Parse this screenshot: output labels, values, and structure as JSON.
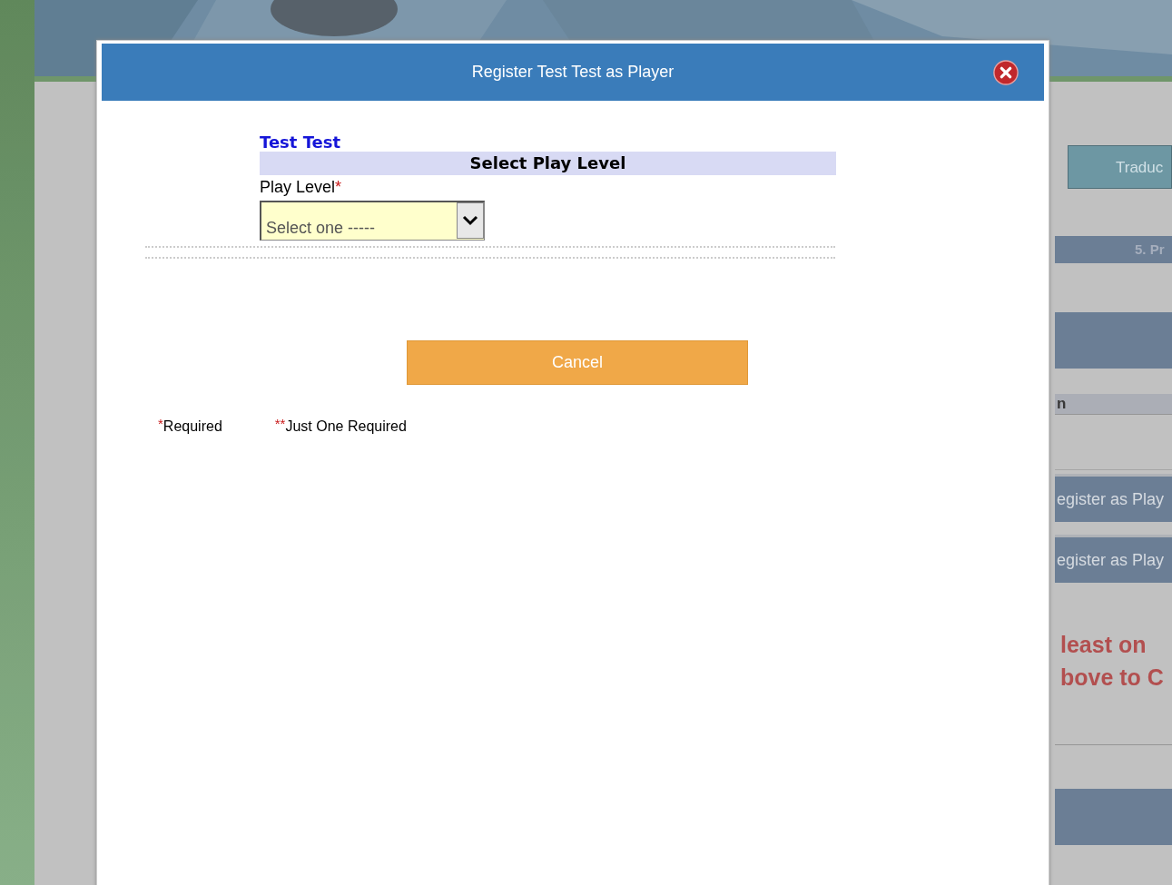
{
  "background": {
    "translate_button": "Traduc",
    "section_heading": "5. Pr",
    "column_fragment": "n",
    "register_buttons": [
      "egister as Play",
      "egister as Play"
    ],
    "notice_lines": [
      "least on",
      "bove to C"
    ]
  },
  "dialog": {
    "title": "Register Test Test as Player",
    "person_name": "Test Test",
    "section_title": "Select Play Level",
    "field": {
      "label": "Play Level",
      "required_mark": "*",
      "value": "Select one -----"
    },
    "cancel_button": "Cancel",
    "legend": [
      {
        "mark": "*",
        "text": "Required"
      },
      {
        "mark": "**",
        "text": "Just One Required"
      }
    ]
  }
}
